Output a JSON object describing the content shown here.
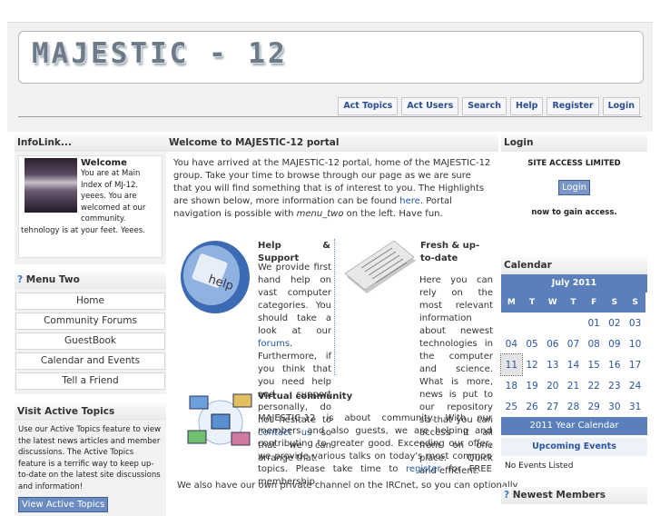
{
  "site": {
    "logo_text": "MAJESTIC - 12"
  },
  "topnav": [
    "Act Topics",
    "Act Users",
    "Search",
    "Help",
    "Register",
    "Login"
  ],
  "left": {
    "infolink_title": "InfoLink...",
    "welcome_title": "Welcome",
    "welcome_text": "You are at Main Index of MJ-12. yeees. You are welcomed at our community. tehnology is at your feet. Yeees.",
    "menu_title": "Menu Two",
    "menu_items": [
      "Home",
      "Community Forums",
      "GuestBook",
      "Calendar and Events",
      "Tell a Friend"
    ],
    "visit_title": "Visit Active Topics",
    "visit_text": "Use our Active Topics feature to view the latest news articles and member discussions. The Active Topics feature is a terrific way to keep up-to-date on the latest site discussions and information!",
    "visit_button": "View Active Topics"
  },
  "center": {
    "title": "Welcome to MAJESTIC-12 portal",
    "intro_1": "You have arrived at the MAJESTIC-12 portal, home of the MAJESTIC-12 group. Take your time to browse through our page as we are sure that you will find something that is of interest to you. The Highlights are shown below, more information can be found ",
    "intro_link": "here",
    "intro_2": ". Portal navigation is possible with ",
    "intro_em": "menu_two",
    "intro_3": " on the left. Have fun.",
    "help_title": "Help & Support",
    "help_img_text": "help",
    "help_1": "We provide first hand help on vast computer categories. You should take a look at our ",
    "help_link1": "forums",
    "help_2": ". Furthermore, if you think that you need help and support personally, do not hesitate to ",
    "help_link2": "contact us",
    "help_3": " so that we can arrange that.",
    "fresh_title": "Fresh & up-to-date",
    "fresh_text": "Here you can rely on the most relevant information about newest technologies in the computer and science. What is more, news is put to our repository so that you can access it all from on one place. Quick and efficient.",
    "virtual_title": "Virtual community",
    "virtual_1": "MAJESTIC-12 is about community. With our members and also guests, we are helping and contributing to greater good. Exceeding our offer, we provide various talks on today's most common topics. Please take time to ",
    "virtual_link": "register",
    "virtual_2": " for FREE membership.",
    "virtual_3": "We also have our own private channel on the IRCnet, so you can optionally"
  },
  "right": {
    "login_title": "Login",
    "site_access": "SITE ACCESS LIMITED",
    "login_button": "Login",
    "gain_access": "now to gain access.",
    "calendar_title": "Calendar",
    "month": "July 2011",
    "weekdays": [
      "M",
      "T",
      "W",
      "T",
      "F",
      "S",
      "S"
    ],
    "weeks": [
      [
        "",
        "",
        "",
        "",
        "01",
        "02",
        "03"
      ],
      [
        "04",
        "05",
        "06",
        "07",
        "08",
        "09",
        "10"
      ],
      [
        "11",
        "12",
        "13",
        "14",
        "15",
        "16",
        "17"
      ],
      [
        "18",
        "19",
        "20",
        "21",
        "22",
        "23",
        "24"
      ],
      [
        "25",
        "26",
        "27",
        "28",
        "29",
        "30",
        "31"
      ]
    ],
    "today": "11",
    "year_calendar": "2011 Year Calendar",
    "upcoming_title": "Upcoming Events",
    "no_events": "No Events Listed",
    "newest_title": "Newest Members"
  },
  "colors": {
    "accent": "#5a7fba",
    "link": "#2255aa",
    "nav_text": "#2b4d90"
  }
}
